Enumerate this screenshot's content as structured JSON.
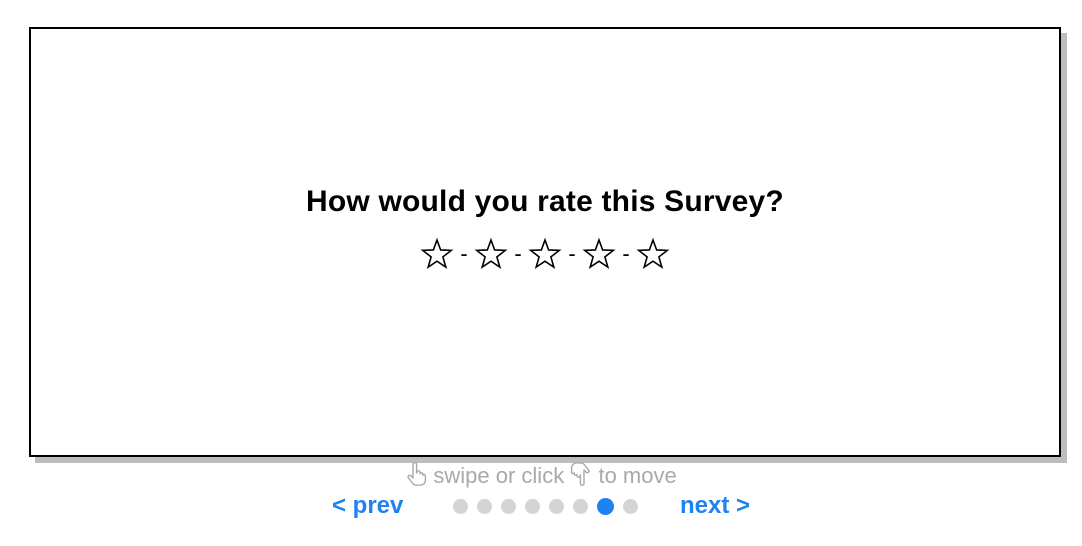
{
  "survey": {
    "question": "How would you rate this Survey?",
    "rating": {
      "max": 5,
      "selected": 0,
      "separator": "-"
    }
  },
  "hint": {
    "text": "swipe or click",
    "text_after": "to move",
    "icon_left": "pointing-hand-icon",
    "icon_right": "pointing-hand-down-icon"
  },
  "navigation": {
    "prev_label": "< prev",
    "next_label": "next >",
    "page_count": 8,
    "current_page": 7
  },
  "colors": {
    "accent": "#1e82f0",
    "dot_inactive": "#d4d4d4",
    "hint": "#a9a9a9",
    "card_shadow": "#bdbdbd"
  }
}
